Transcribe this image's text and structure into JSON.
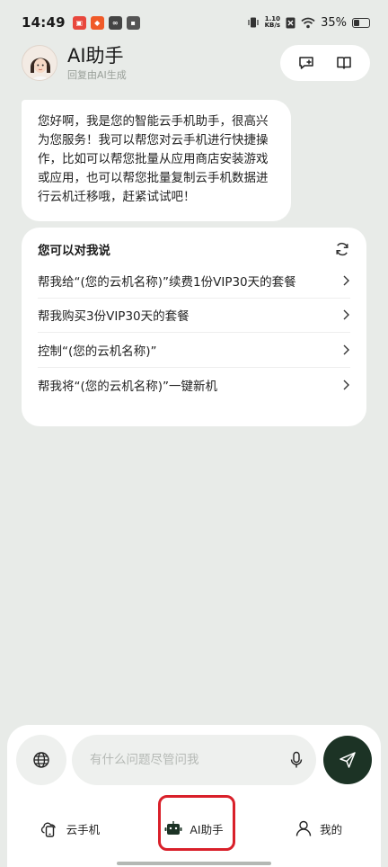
{
  "status_bar": {
    "time": "14:49",
    "net_speed_value": "1.10",
    "net_speed_unit": "KB/s",
    "battery": "35%"
  },
  "header": {
    "title": "AI助手",
    "subtitle": "回复由AI生成"
  },
  "greeting": "您好啊，我是您的智能云手机助手，很高兴为您服务！我可以帮您对云手机进行快捷操作，比如可以帮您批量从应用商店安装游戏或应用，也可以帮您批量复制云手机数据进行云机迁移哦，赶紧试试吧！",
  "suggestions": {
    "title": "您可以对我说",
    "items": [
      {
        "label": "帮我给“(您的云机名称)”续费1份VIP30天的套餐"
      },
      {
        "label": "帮我购买3份VIP30天的套餐"
      },
      {
        "label": "控制“(您的云机名称)”"
      },
      {
        "label": "帮我将“(您的云机名称)”一键新机"
      }
    ]
  },
  "input": {
    "placeholder": "有什么问题尽管问我",
    "value": ""
  },
  "nav": {
    "items": [
      {
        "label": "云手机",
        "icon": "cloud-phone-icon"
      },
      {
        "label": "AI助手",
        "icon": "robot-icon",
        "active": true
      },
      {
        "label": "我的",
        "icon": "person-icon"
      }
    ]
  },
  "colors": {
    "background": "#e8ebe8",
    "send_button": "#1c3325",
    "highlight": "#d9202a"
  }
}
